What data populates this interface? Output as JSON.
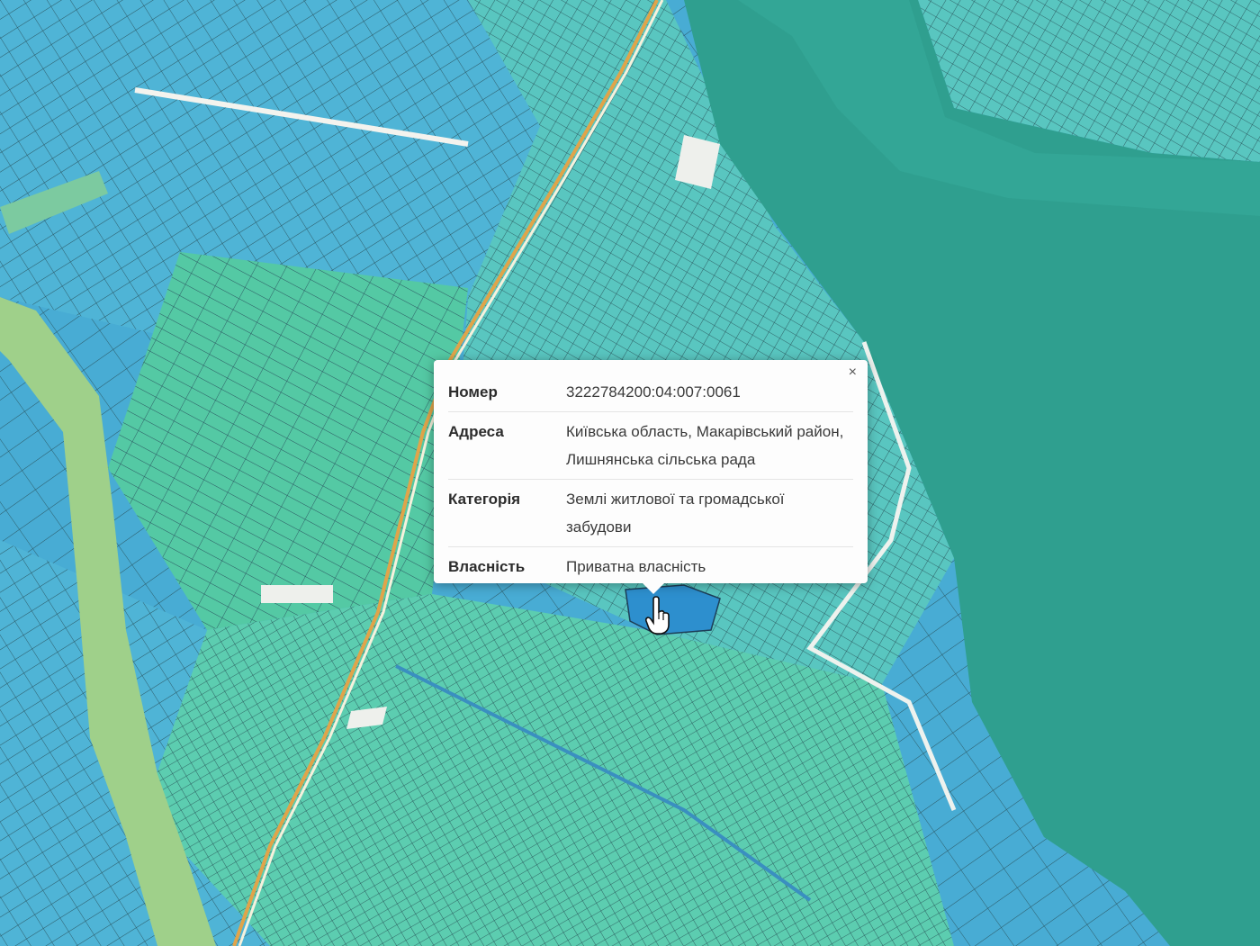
{
  "map": {
    "colors": {
      "parcel_blue": "#4fb4d6",
      "parcel_green": "#54c9a4",
      "water_teal": "#2f9f8f",
      "road_green": "#9fd08a",
      "road_line": "#e0a44a",
      "parcel_border": "#2b5560"
    }
  },
  "popup": {
    "close_glyph": "×",
    "rows": [
      {
        "key": "Номер",
        "value": "3222784200:04:007:0061"
      },
      {
        "key": "Адреса",
        "value": "Київська область, Макарівський район, Лишнянська сільська рада"
      },
      {
        "key": "Категорія",
        "value": "Землі житлової та громадської забудови"
      },
      {
        "key": "Власність",
        "value": "Приватна власність"
      }
    ]
  },
  "cursor": {
    "icon": "hand-pointer-icon"
  }
}
